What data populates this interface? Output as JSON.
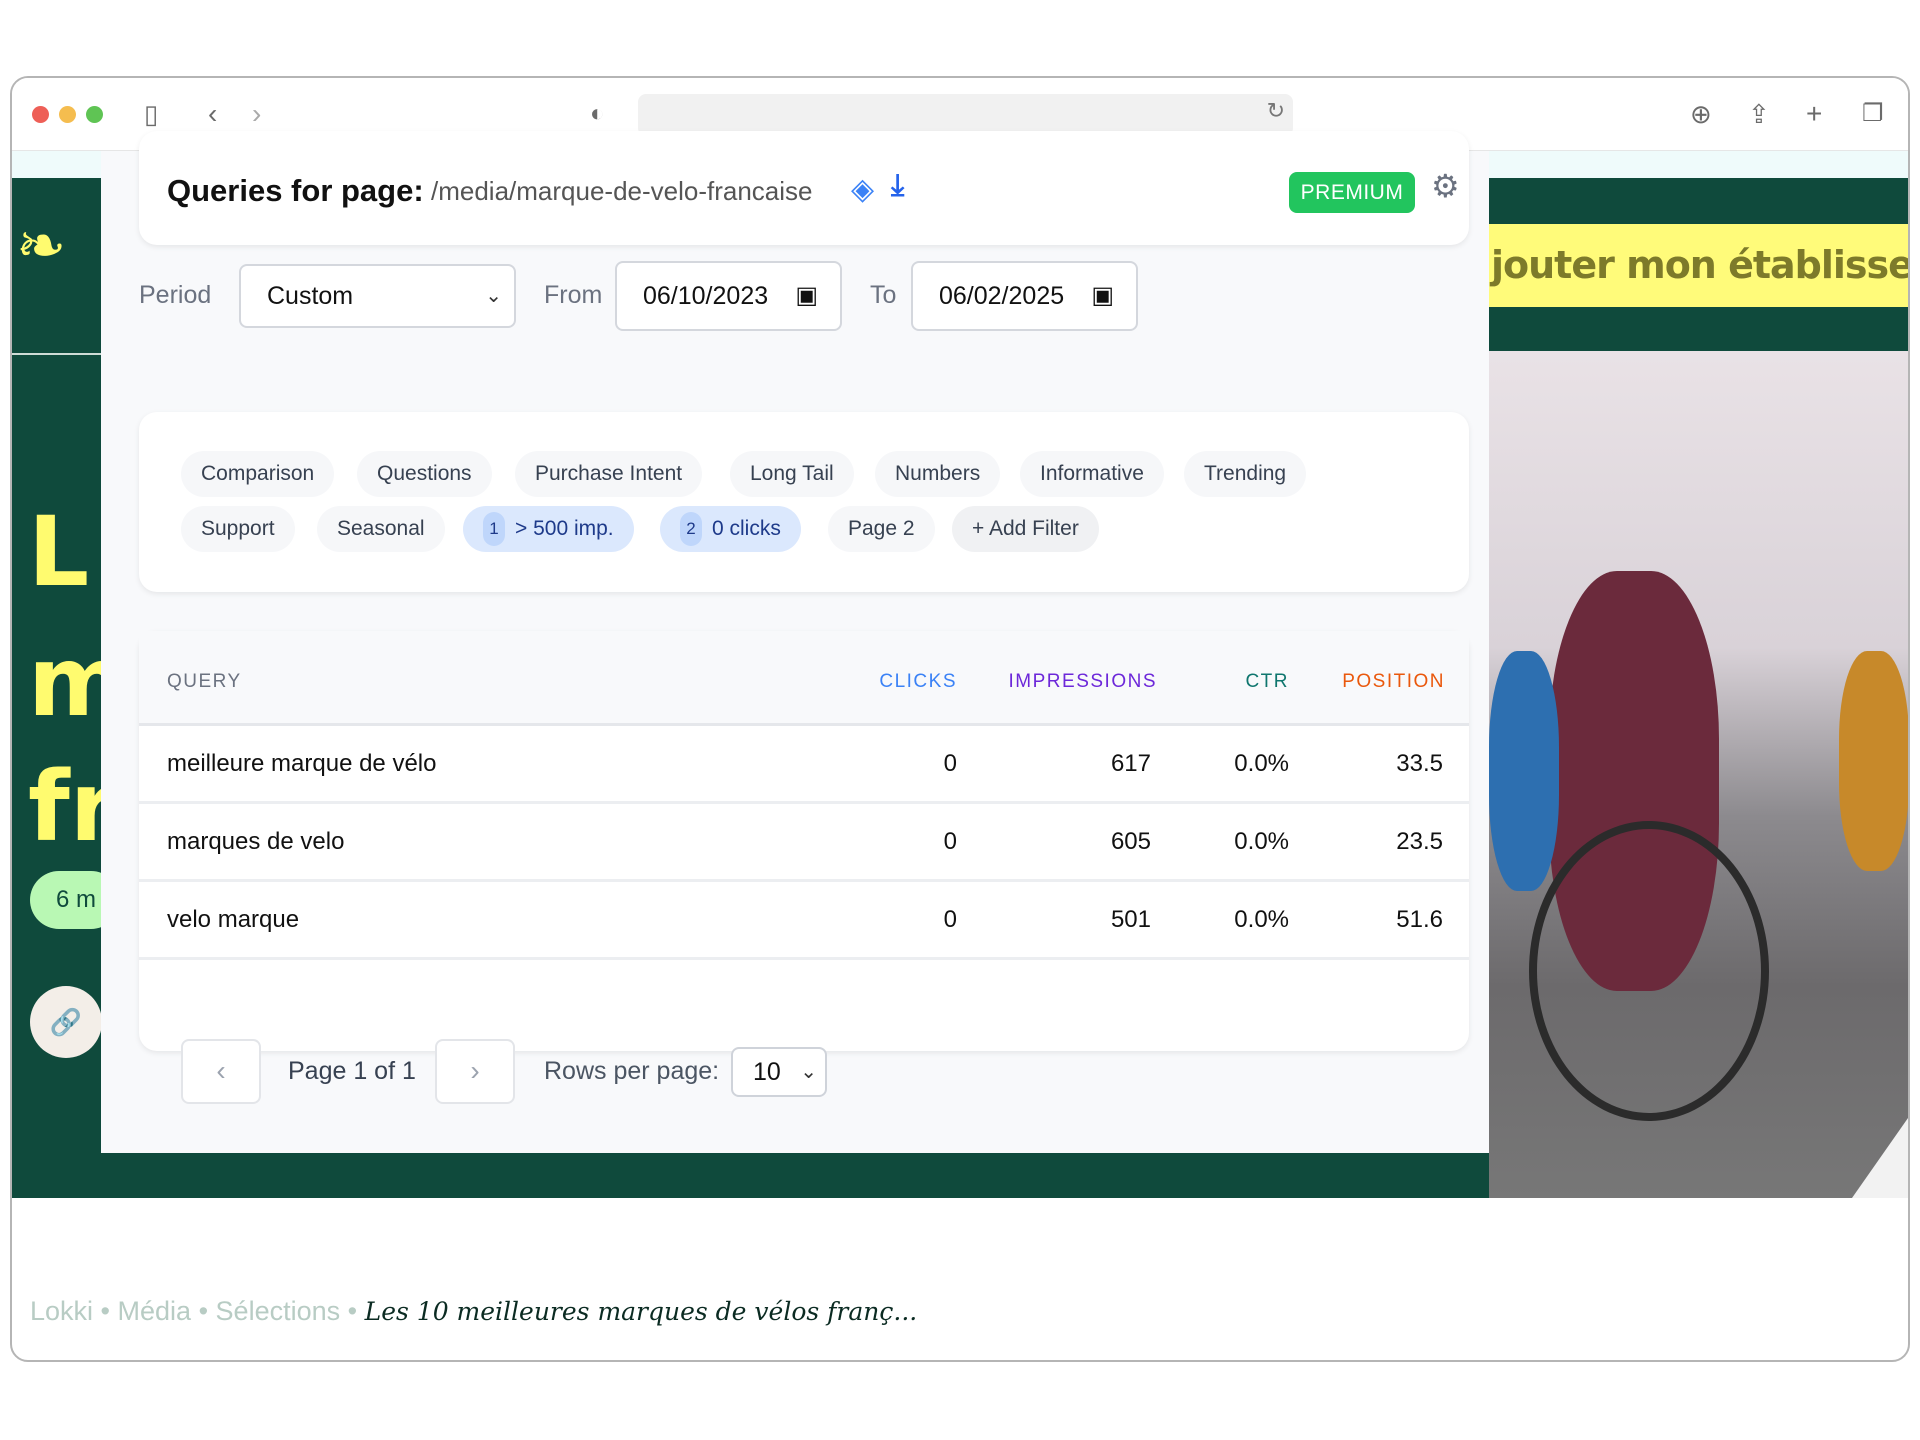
{
  "browser": {
    "icons": [
      "sidebar-icon",
      "back-icon",
      "forward-icon",
      "shield-icon",
      "reload-icon",
      "download-icon",
      "share-icon",
      "new-tab-icon",
      "tabs-icon"
    ]
  },
  "background": {
    "banner_text": "jouter mon établisseme",
    "pill_text": "6 m",
    "breadcrumb": [
      "Lokki",
      "Média",
      "Sélections"
    ],
    "breadcrumb_separator": "•",
    "breadcrumb_current": "Les 10 meilleures marques de vélos franç..."
  },
  "header": {
    "title": "Queries for page:",
    "path": "/media/marque-de-velo-francaise",
    "badge": "PREMIUM",
    "badge_color": "#22c55e"
  },
  "period": {
    "label": "Period",
    "value": "Custom",
    "from_label": "From",
    "from": "06/10/2023",
    "to_label": "To",
    "to": "06/02/2025"
  },
  "filters": {
    "chips": [
      "Comparison",
      "Questions",
      "Purchase Intent",
      "Long Tail",
      "Numbers",
      "Informative",
      "Trending",
      "Support",
      "Seasonal"
    ],
    "active": [
      {
        "num": "1",
        "label": "> 500 imp."
      },
      {
        "num": "2",
        "label": "0 clicks"
      }
    ],
    "page2": "Page 2",
    "add": "Add Filter"
  },
  "table": {
    "headers": {
      "query": "QUERY",
      "clicks": "CLICKS",
      "impressions": "IMPRESSIONS",
      "ctr": "CTR",
      "position": "POSITION"
    },
    "header_colors": {
      "clicks": "#3b82f6",
      "impressions": "#6d28d9",
      "ctr": "#0f766e",
      "position": "#ea580c"
    },
    "rows": [
      {
        "query": "meilleure marque de vélo",
        "clicks": "0",
        "impressions": "617",
        "ctr": "0.0%",
        "position": "33.5"
      },
      {
        "query": "marques de velo",
        "clicks": "0",
        "impressions": "605",
        "ctr": "0.0%",
        "position": "23.5"
      },
      {
        "query": "velo marque",
        "clicks": "0",
        "impressions": "501",
        "ctr": "0.0%",
        "position": "51.6"
      }
    ]
  },
  "pagination": {
    "page_text": "Page 1 of 1",
    "rows_label": "Rows per page:",
    "rows_value": "10"
  }
}
